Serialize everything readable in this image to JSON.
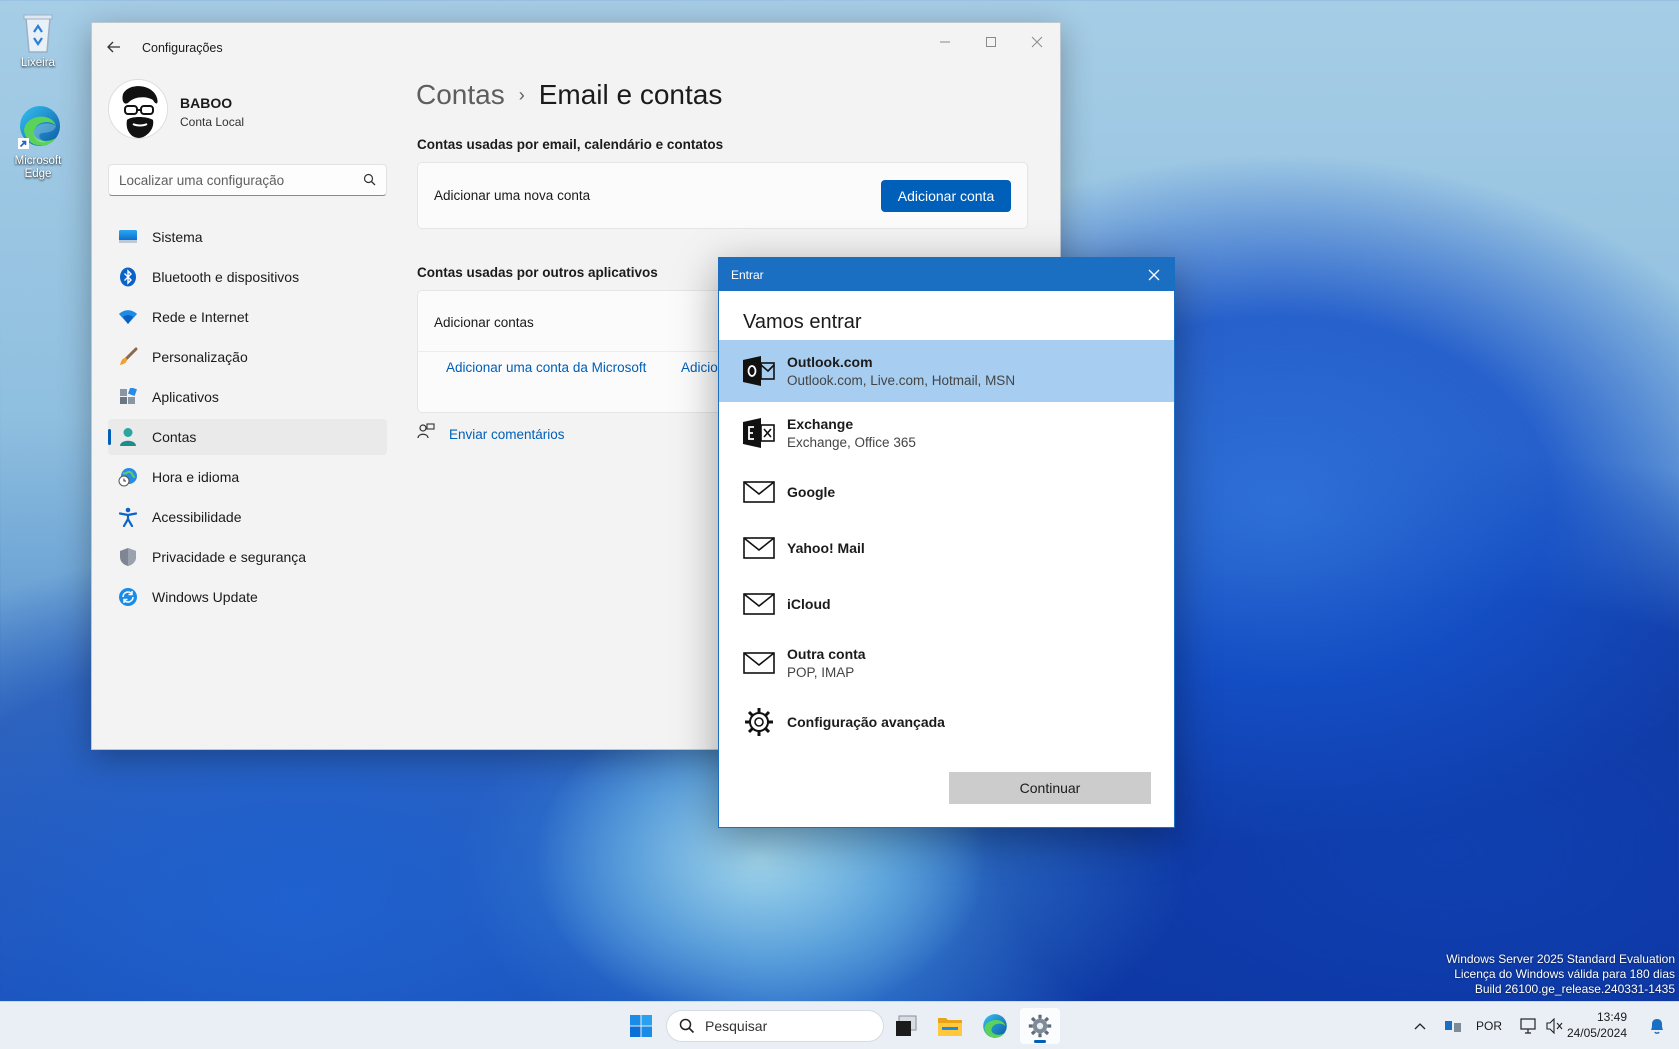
{
  "desktop": {
    "icons": [
      {
        "label": "Lixeira"
      },
      {
        "label": "Microsoft Edge"
      }
    ],
    "watermark": [
      "Windows Server 2025 Standard Evaluation",
      "Licença do Windows válida para 180 dias",
      "Build 26100.ge_release.240331-1435"
    ]
  },
  "settings": {
    "title": "Configurações",
    "user": {
      "name": "BABOO",
      "account_type": "Conta Local"
    },
    "search_placeholder": "Localizar uma configuração",
    "nav": [
      {
        "label": "Sistema",
        "icon": "monitor-icon"
      },
      {
        "label": "Bluetooth e dispositivos",
        "icon": "bluetooth-icon"
      },
      {
        "label": "Rede e Internet",
        "icon": "wifi-icon"
      },
      {
        "label": "Personalização",
        "icon": "brush-icon"
      },
      {
        "label": "Aplicativos",
        "icon": "apps-icon"
      },
      {
        "label": "Contas",
        "icon": "person-icon",
        "selected": true
      },
      {
        "label": "Hora e idioma",
        "icon": "globe-clock-icon"
      },
      {
        "label": "Acessibilidade",
        "icon": "accessibility-icon"
      },
      {
        "label": "Privacidade e segurança",
        "icon": "shield-icon"
      },
      {
        "label": "Windows Update",
        "icon": "update-icon"
      }
    ],
    "breadcrumb": {
      "parent": "Contas",
      "separator": "›",
      "current": "Email e contas"
    },
    "section1": {
      "title": "Contas usadas por email, calendário e contatos",
      "card_text": "Adicionar uma nova conta",
      "button": "Adicionar conta"
    },
    "section2": {
      "title": "Contas usadas por outros aplicativos",
      "card_text": "Adicionar contas",
      "link1": "Adicionar uma conta da Microsoft",
      "link2": "Adicio"
    },
    "feedback": "Enviar comentários"
  },
  "dialog": {
    "title": "Entrar",
    "heading": "Vamos entrar",
    "providers": [
      {
        "name": "Outlook.com",
        "sub": "Outlook.com, Live.com, Hotmail, MSN",
        "icon": "outlook-icon",
        "selected": true
      },
      {
        "name": "Exchange",
        "sub": "Exchange, Office 365",
        "icon": "exchange-icon"
      },
      {
        "name": "Google",
        "sub": "",
        "icon": "mail-icon"
      },
      {
        "name": "Yahoo! Mail",
        "sub": "",
        "icon": "mail-icon"
      },
      {
        "name": "iCloud",
        "sub": "",
        "icon": "mail-icon"
      },
      {
        "name": "Outra conta",
        "sub": "POP, IMAP",
        "icon": "mail-icon"
      },
      {
        "name": "Configuração avançada",
        "sub": "",
        "icon": "gear-icon"
      }
    ],
    "continue": "Continuar"
  },
  "taskbar": {
    "search_label": "Pesquisar",
    "language": "POR",
    "time": "13:49",
    "date": "24/05/2024"
  },
  "colors": {
    "accent": "#005fb8",
    "dialog_bar": "#1a6fc2",
    "selected_row": "#a7cdf0"
  }
}
